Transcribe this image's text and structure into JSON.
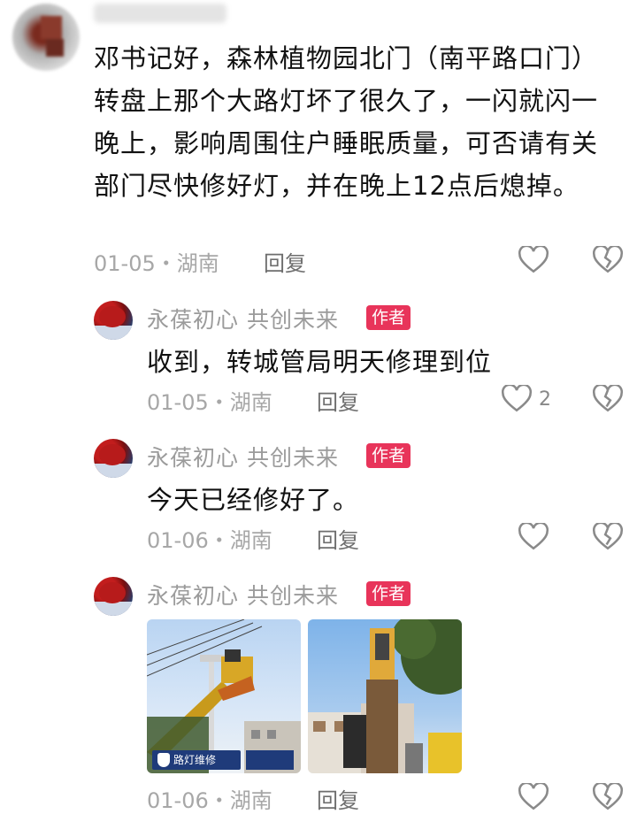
{
  "top_comment": {
    "text": "邓书记好，森林植物园北门（南平路口门）转盘上那个大路灯坏了很久了，一闪就闪一晚上，影响周围住户睡眠质量，可否请有关部门尽快修好灯，并在晚上12点后熄掉。",
    "date_location": "01-05・湖南",
    "reply_label": "回复"
  },
  "replies": [
    {
      "author": "永葆初心  共创未来",
      "badge": "作者",
      "text": "收到，转城管局明天修理到位",
      "date_location": "01-05・湖南",
      "reply_label": "回复",
      "like_count": "2"
    },
    {
      "author": "永葆初心  共创未来",
      "badge": "作者",
      "text": "今天已经修好了。",
      "date_location": "01-06・湖南",
      "reply_label": "回复"
    },
    {
      "author": "永葆初心  共创未来",
      "badge": "作者",
      "date_location": "01-06・湖南",
      "reply_label": "回复",
      "photo_caption": "路灯维修"
    }
  ],
  "icons": {
    "like": "heart-outline-icon",
    "dislike": "broken-heart-icon"
  },
  "colors": {
    "badge": "#e8345a",
    "meta": "#a7a7a7",
    "reply": "#6e6e6e"
  }
}
